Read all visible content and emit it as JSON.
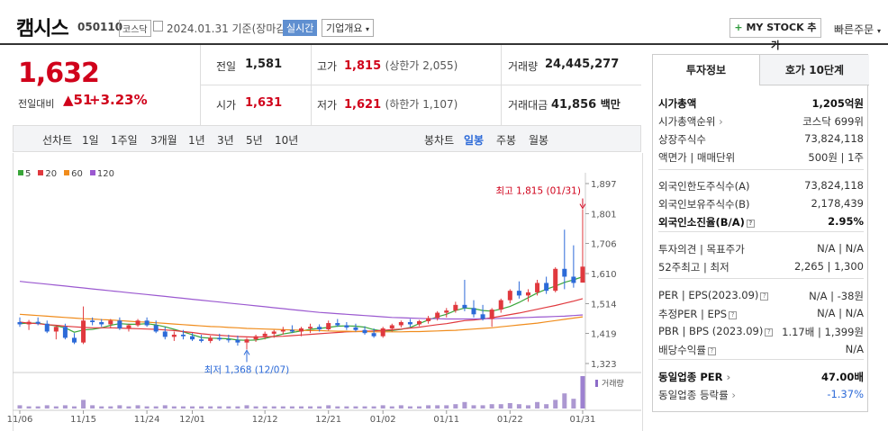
{
  "header": {
    "title": "캠시스",
    "code": "050110",
    "market": "코스닥",
    "date": "2024.01.31 기준(장마감)",
    "live": "실시간",
    "company_info": "기업개요",
    "mystock": "MY STOCK 추가",
    "quick_order": "빠른주문"
  },
  "summary": {
    "price": "1,632",
    "change_label": "전일대비",
    "change": "51",
    "change_pct": "+3.23%",
    "prev_label": "전일",
    "prev": "1,581",
    "high_label": "고가",
    "high": "1,815",
    "upper_limit": "(상한가 2,055)",
    "volume_label": "거래량",
    "volume": "24,445,277",
    "open_label": "시가",
    "open": "1,631",
    "low_label": "저가",
    "low": "1,621",
    "lower_limit": "(하한가 1,107)",
    "amount_label": "거래대금",
    "amount": "41,856",
    "amount_unit": "백만"
  },
  "period_bar": {
    "line_label": "선차트",
    "periods": [
      "1일",
      "1주일",
      "3개월",
      "1년",
      "3년",
      "5년",
      "10년"
    ],
    "candle_label": "봉차트",
    "candles": [
      "일봉",
      "주봉",
      "월봉"
    ],
    "active_candle": "일봉"
  },
  "right_panel": {
    "tabs": [
      "투자정보",
      "호가 10단계"
    ],
    "rows": [
      {
        "k": "시가총액",
        "v": "1,205억원",
        "bold": true
      },
      {
        "k": "시가총액순위",
        "v": "코스닥 699위",
        "arrow": true
      },
      {
        "k": "상장주식수",
        "v": "73,824,118"
      },
      {
        "k": "액면가 | 매매단위",
        "v": "500원 | 1주"
      },
      {
        "k": "외국인한도주식수(A)",
        "v": "73,824,118"
      },
      {
        "k": "외국인보유주식수(B)",
        "v": "2,178,439"
      },
      {
        "k": "외국인소진율(B/A)",
        "v": "2.95%",
        "bold": true,
        "q": true
      },
      {
        "k": "투자의견 | 목표주가",
        "v": "N/A | N/A"
      },
      {
        "k": "52주최고 | 최저",
        "v": "2,265 | 1,300"
      },
      {
        "k": "PER | EPS(2023.09)",
        "v": "N/A | -38원",
        "q": true
      },
      {
        "k": "추정PER | EPS",
        "v": "N/A | N/A",
        "q": true
      },
      {
        "k": "PBR | BPS (2023.09)",
        "v": "1.17배 | 1,399원",
        "q": true
      },
      {
        "k": "배당수익률",
        "v": "N/A",
        "q": true
      },
      {
        "k": "동일업종 PER",
        "v": "47.00배",
        "bold": true,
        "arrow": true
      },
      {
        "k": "동일업종 등락률",
        "v": "-1.37%",
        "arrow": true,
        "neg": true
      }
    ]
  },
  "chart_data": {
    "type": "candlestick",
    "legend": [
      {
        "name": "5",
        "color": "#3aa63a"
      },
      {
        "name": "20",
        "color": "#e0393e"
      },
      {
        "name": "60",
        "color": "#f08c1c"
      },
      {
        "name": "120",
        "color": "#9b59d0"
      }
    ],
    "y_ticks": [
      "1,897",
      "1,801",
      "1,706",
      "1,610",
      "1,514",
      "1,419",
      "1,323"
    ],
    "ylim": [
      1323,
      1897
    ],
    "x_ticks": [
      "11/06",
      "11/15",
      "11/24",
      "12/01",
      "12/12",
      "12/21",
      "01/02",
      "01/11",
      "01/22",
      "01/31"
    ],
    "high_annotation": "최고 1,815 (01/31)",
    "low_annotation": "최저 1,368 (12/07)",
    "volume_label": "거래량",
    "candles": [
      [
        1455,
        1470,
        1440,
        1448
      ],
      [
        1448,
        1462,
        1430,
        1456
      ],
      [
        1456,
        1470,
        1445,
        1450
      ],
      [
        1450,
        1460,
        1420,
        1425
      ],
      [
        1425,
        1445,
        1400,
        1440
      ],
      [
        1440,
        1450,
        1400,
        1405
      ],
      [
        1405,
        1420,
        1385,
        1390
      ],
      [
        1390,
        1505,
        1385,
        1460
      ],
      [
        1460,
        1470,
        1445,
        1455
      ],
      [
        1455,
        1465,
        1440,
        1448
      ],
      [
        1448,
        1465,
        1435,
        1460
      ],
      [
        1460,
        1470,
        1430,
        1435
      ],
      [
        1435,
        1450,
        1425,
        1445
      ],
      [
        1445,
        1465,
        1440,
        1460
      ],
      [
        1460,
        1470,
        1440,
        1445
      ],
      [
        1445,
        1460,
        1420,
        1425
      ],
      [
        1425,
        1440,
        1400,
        1408
      ],
      [
        1408,
        1425,
        1395,
        1415
      ],
      [
        1415,
        1430,
        1400,
        1410
      ],
      [
        1410,
        1420,
        1395,
        1400
      ],
      [
        1400,
        1415,
        1390,
        1395
      ],
      [
        1395,
        1412,
        1388,
        1405
      ],
      [
        1405,
        1418,
        1395,
        1400
      ],
      [
        1400,
        1415,
        1390,
        1398
      ],
      [
        1398,
        1412,
        1380,
        1390
      ],
      [
        1390,
        1405,
        1368,
        1400
      ],
      [
        1400,
        1415,
        1392,
        1410
      ],
      [
        1410,
        1425,
        1400,
        1418
      ],
      [
        1418,
        1430,
        1405,
        1425
      ],
      [
        1425,
        1440,
        1415,
        1430
      ],
      [
        1430,
        1445,
        1420,
        1425
      ],
      [
        1425,
        1440,
        1410,
        1435
      ],
      [
        1435,
        1450,
        1420,
        1440
      ],
      [
        1440,
        1448,
        1425,
        1432
      ],
      [
        1432,
        1460,
        1428,
        1452
      ],
      [
        1452,
        1465,
        1440,
        1445
      ],
      [
        1445,
        1455,
        1430,
        1438
      ],
      [
        1438,
        1450,
        1425,
        1430
      ],
      [
        1430,
        1442,
        1415,
        1420
      ],
      [
        1420,
        1435,
        1405,
        1410
      ],
      [
        1410,
        1440,
        1405,
        1435
      ],
      [
        1435,
        1450,
        1425,
        1445
      ],
      [
        1445,
        1460,
        1438,
        1455
      ],
      [
        1455,
        1465,
        1440,
        1448
      ],
      [
        1448,
        1462,
        1442,
        1458
      ],
      [
        1458,
        1475,
        1450,
        1468
      ],
      [
        1468,
        1490,
        1460,
        1485
      ],
      [
        1485,
        1500,
        1470,
        1492
      ],
      [
        1492,
        1520,
        1485,
        1510
      ],
      [
        1510,
        1590,
        1490,
        1500
      ],
      [
        1500,
        1525,
        1470,
        1480
      ],
      [
        1480,
        1510,
        1460,
        1465
      ],
      [
        1465,
        1500,
        1440,
        1495
      ],
      [
        1495,
        1530,
        1485,
        1525
      ],
      [
        1525,
        1560,
        1515,
        1555
      ],
      [
        1555,
        1585,
        1530,
        1540
      ],
      [
        1540,
        1560,
        1520,
        1550
      ],
      [
        1550,
        1590,
        1540,
        1580
      ],
      [
        1580,
        1600,
        1545,
        1555
      ],
      [
        1555,
        1630,
        1550,
        1625
      ],
      [
        1625,
        1750,
        1560,
        1600
      ],
      [
        1600,
        1700,
        1565,
        1580
      ],
      [
        1581,
        1815,
        1621,
        1632
      ]
    ],
    "volumes": [
      3,
      2,
      2,
      3,
      2,
      3,
      2,
      8,
      3,
      2,
      2,
      3,
      2,
      3,
      2,
      2,
      3,
      2,
      2,
      2,
      2,
      2,
      2,
      2,
      2,
      3,
      2,
      2,
      2,
      2,
      2,
      2,
      2,
      2,
      3,
      2,
      2,
      2,
      2,
      2,
      3,
      2,
      3,
      2,
      2,
      3,
      3,
      3,
      4,
      6,
      3,
      3,
      4,
      4,
      5,
      4,
      3,
      6,
      4,
      8,
      14,
      9,
      30
    ],
    "ma": {
      "5": [
        1450,
        1452,
        1452,
        1447,
        1443,
        1437,
        1423,
        1430,
        1432,
        1437,
        1445,
        1450,
        1448,
        1448,
        1450,
        1446,
        1440,
        1432,
        1424,
        1415,
        1406,
        1404,
        1403,
        1402,
        1398,
        1397,
        1398,
        1403,
        1410,
        1417,
        1422,
        1427,
        1432,
        1435,
        1438,
        1442,
        1443,
        1442,
        1439,
        1431,
        1427,
        1428,
        1432,
        1438,
        1450,
        1462,
        1472,
        1480,
        1492,
        1500,
        1498,
        1492,
        1490,
        1497,
        1505,
        1518,
        1533,
        1548,
        1560,
        1570,
        1582,
        1590,
        1600
      ],
      "20": [
        1455,
        1452,
        1450,
        1447,
        1445,
        1442,
        1440,
        1438,
        1437,
        1437,
        1437,
        1436,
        1435,
        1434,
        1433,
        1432,
        1430,
        1428,
        1425,
        1422,
        1418,
        1415,
        1413,
        1411,
        1409,
        1408,
        1407,
        1408,
        1409,
        1410,
        1412,
        1414,
        1416,
        1418,
        1420,
        1422,
        1424,
        1425,
        1426,
        1427,
        1429,
        1431,
        1433,
        1436,
        1439,
        1443,
        1447,
        1450,
        1455,
        1460,
        1462,
        1465,
        1469,
        1474,
        1479,
        1484,
        1490,
        1496,
        1502,
        1508,
        1515,
        1522,
        1530
      ],
      "60": [
        1480,
        1478,
        1476,
        1474,
        1472,
        1470,
        1468,
        1466,
        1465,
        1463,
        1462,
        1460,
        1458,
        1456,
        1455,
        1453,
        1451,
        1449,
        1447,
        1445,
        1443,
        1441,
        1440,
        1438,
        1437,
        1435,
        1434,
        1433,
        1432,
        1431,
        1430,
        1429,
        1428,
        1428,
        1427,
        1426,
        1426,
        1425,
        1425,
        1424,
        1424,
        1424,
        1424,
        1425,
        1425,
        1426,
        1427,
        1428,
        1429,
        1431,
        1433,
        1435,
        1437,
        1440,
        1443,
        1446,
        1449,
        1452,
        1456,
        1460,
        1464,
        1468,
        1472
      ],
      "120": [
        1585,
        1582,
        1579,
        1576,
        1573,
        1570,
        1567,
        1564,
        1561,
        1558,
        1555,
        1552,
        1549,
        1546,
        1543,
        1540,
        1537,
        1534,
        1531,
        1528,
        1525,
        1522,
        1519,
        1516,
        1513,
        1510,
        1507,
        1504,
        1501,
        1498,
        1495,
        1492,
        1489,
        1486,
        1484,
        1482,
        1480,
        1478,
        1476,
        1474,
        1472,
        1470,
        1469,
        1468,
        1467,
        1466,
        1466,
        1465,
        1465,
        1465,
        1465,
        1466,
        1466,
        1467,
        1468,
        1469,
        1470,
        1471,
        1472,
        1473,
        1474,
        1476,
        1478
      ]
    }
  }
}
